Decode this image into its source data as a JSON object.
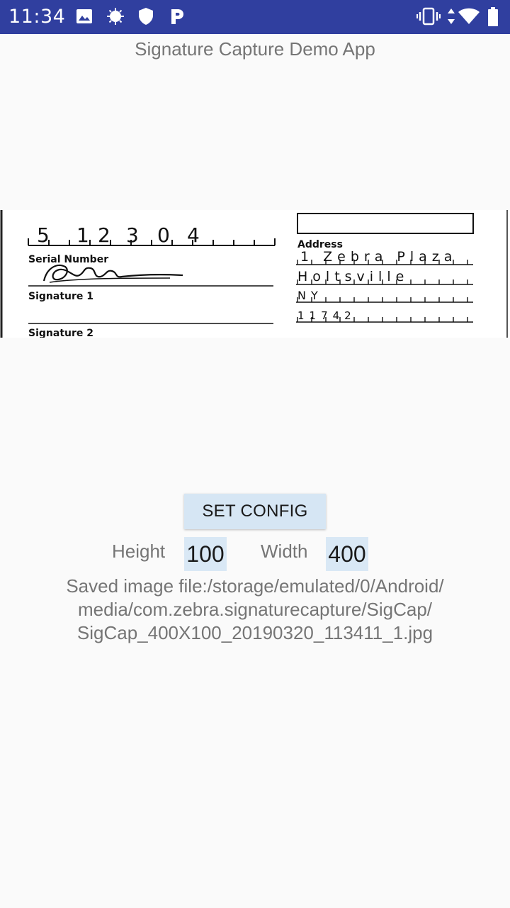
{
  "status_bar": {
    "time": "11:34",
    "bg_color": "#303f9f",
    "left_icons": [
      "image-icon",
      "sun-icon",
      "shield-icon",
      "parking-icon"
    ],
    "right_icons": [
      "vibrate-icon",
      "data-arrows-icon",
      "wifi-icon",
      "battery-icon"
    ]
  },
  "app": {
    "title": "Signature Capture Demo App"
  },
  "captured_image": {
    "serial_digits": [
      "5",
      "1",
      "2",
      "3",
      "0",
      "4"
    ],
    "serial_label": "Serial Number",
    "signature1_label": "Signature 1",
    "signature2_label": "Signature 2",
    "address_label": "Address",
    "address_line1": "1 Zebra Plaza",
    "address_line2": "Holtsville",
    "address_line3": "NY",
    "address_line4": "11742"
  },
  "config": {
    "button_label": "SET CONFIG",
    "height_label": "Height",
    "height_value": "100",
    "width_label": "Width",
    "width_value": "400"
  },
  "saved": {
    "line1": "Saved image file:/storage/emulated/0/Android/",
    "line2": "media/com.zebra.signaturecapture/SigCap/",
    "line3": "SigCap_400X100_20190320_113411_1.jpg"
  }
}
